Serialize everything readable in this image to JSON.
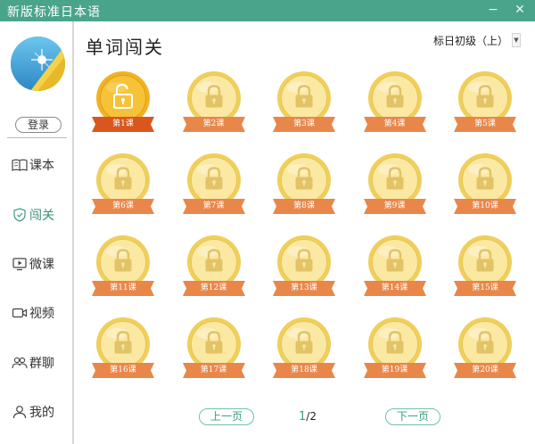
{
  "window": {
    "title": "新版标准日本语",
    "minimize": "−",
    "maximize": "▢",
    "close": "✕"
  },
  "sidebar": {
    "login_label": "登录",
    "items": [
      {
        "label": "课本",
        "icon": "book-icon"
      },
      {
        "label": "闯关",
        "icon": "shield-icon",
        "active": true
      },
      {
        "label": "微课",
        "icon": "screen-play-icon"
      },
      {
        "label": "视频",
        "icon": "video-camera-icon"
      },
      {
        "label": "群聊",
        "icon": "people-icon"
      },
      {
        "label": "我的",
        "icon": "user-icon"
      }
    ]
  },
  "main": {
    "title": "单词闯关",
    "level": "标日初级（上）",
    "lessons": [
      {
        "label": "第1课",
        "unlocked": true
      },
      {
        "label": "第2课",
        "unlocked": false
      },
      {
        "label": "第3课",
        "unlocked": false
      },
      {
        "label": "第4课",
        "unlocked": false
      },
      {
        "label": "第5课",
        "unlocked": false
      },
      {
        "label": "第6课",
        "unlocked": false
      },
      {
        "label": "第7课",
        "unlocked": false
      },
      {
        "label": "第8课",
        "unlocked": false
      },
      {
        "label": "第9课",
        "unlocked": false
      },
      {
        "label": "第10课",
        "unlocked": false
      },
      {
        "label": "第11课",
        "unlocked": false
      },
      {
        "label": "第12课",
        "unlocked": false
      },
      {
        "label": "第13课",
        "unlocked": false
      },
      {
        "label": "第14课",
        "unlocked": false
      },
      {
        "label": "第15课",
        "unlocked": false
      },
      {
        "label": "第16课",
        "unlocked": false
      },
      {
        "label": "第17课",
        "unlocked": false
      },
      {
        "label": "第18课",
        "unlocked": false
      },
      {
        "label": "第19课",
        "unlocked": false
      },
      {
        "label": "第20课",
        "unlocked": false
      }
    ],
    "pager": {
      "prev_label": "上一页",
      "next_label": "下一页",
      "current": "1",
      "total": "/2"
    }
  },
  "colors": {
    "titlebar": "#4aa48b",
    "accent": "#3a9f7e",
    "ribbon_locked": "#e9874a",
    "ribbon_unlocked": "#d9571f",
    "coin_light": "#fbe9a3",
    "coin_dark": "#f0cf5a",
    "coin_unlocked": "#f1b322"
  }
}
